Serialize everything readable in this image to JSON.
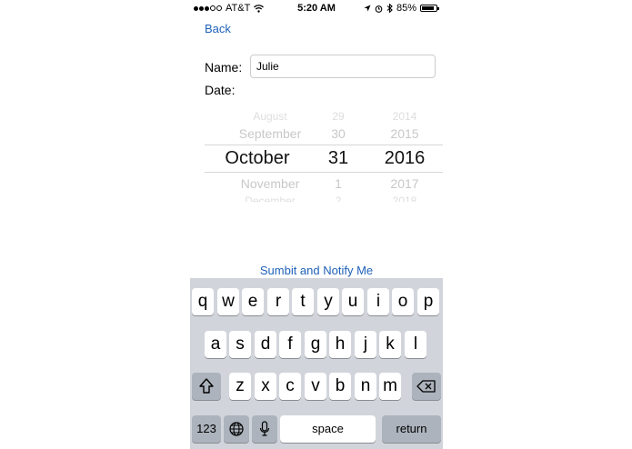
{
  "status": {
    "carrier": "AT&T",
    "time": "5:20 AM",
    "battery": "85%",
    "battery_level": 0.85
  },
  "nav": {
    "back_label": "Back"
  },
  "form": {
    "name_label": "Name:",
    "name_value": "Julie",
    "date_label": "Date:"
  },
  "picker": {
    "months": [
      "August",
      "September",
      "October",
      "November",
      "December"
    ],
    "days": [
      "29",
      "30",
      "31",
      "1",
      "2"
    ],
    "years": [
      "2014",
      "2015",
      "2016",
      "2017",
      "2018"
    ],
    "selected_index": 2
  },
  "submit_label": "Sumbit and Notify Me",
  "keyboard": {
    "row1": [
      "q",
      "w",
      "e",
      "r",
      "t",
      "y",
      "u",
      "i",
      "o",
      "p"
    ],
    "row2": [
      "a",
      "s",
      "d",
      "f",
      "g",
      "h",
      "j",
      "k",
      "l"
    ],
    "row3": [
      "z",
      "x",
      "c",
      "v",
      "b",
      "n",
      "m"
    ],
    "numbers_label": "123",
    "space_label": "space",
    "return_label": "return"
  }
}
